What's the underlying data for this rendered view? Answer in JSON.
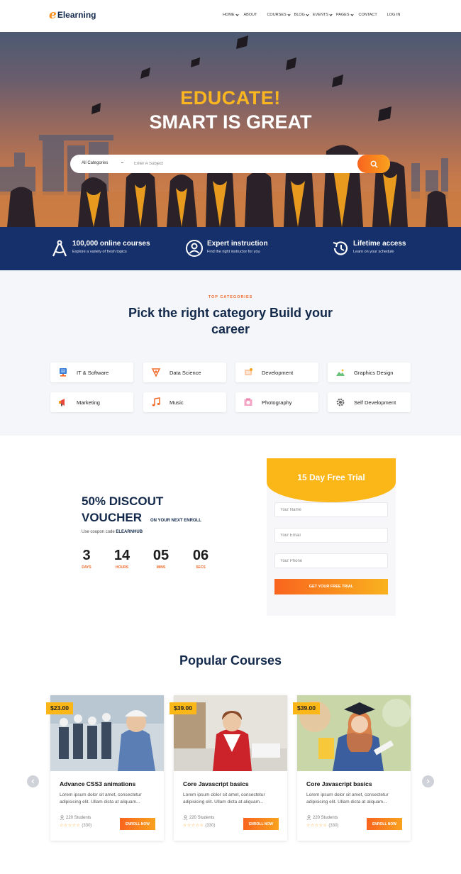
{
  "header": {
    "logo": "Elearning",
    "logo_initial": "e",
    "nav": [
      {
        "label": "HOME",
        "dropdown": true
      },
      {
        "label": "ABOUT",
        "dropdown": false
      },
      {
        "label": "COURSES",
        "dropdown": true
      },
      {
        "label": "BLOG",
        "dropdown": true
      },
      {
        "label": "EVENTS",
        "dropdown": true
      },
      {
        "label": "PAGES",
        "dropdown": true
      },
      {
        "label": "CONTACT",
        "dropdown": false
      },
      {
        "label": "LOG IN",
        "dropdown": false
      }
    ]
  },
  "hero": {
    "title1": "EDUCATE!",
    "title2": "SMART IS GREAT",
    "search": {
      "category": "All Categories",
      "placeholder": "Enter A Subject"
    }
  },
  "features": [
    {
      "title": "100,000 online courses",
      "subtitle": "Explore a variety of fresh topics",
      "icon": "compass-icon"
    },
    {
      "title": "Expert instruction",
      "subtitle": "Find the right instructor for you",
      "icon": "user-circle-icon"
    },
    {
      "title": "Lifetime access",
      "subtitle": "Learn on your schedule",
      "icon": "history-icon"
    }
  ],
  "categories": {
    "eyebrow": "TOP CATEGORIES",
    "title": "Pick the right category Build your career",
    "items": [
      {
        "label": "IT & Software",
        "icon": "server-icon"
      },
      {
        "label": "Data Science",
        "icon": "data-science-icon"
      },
      {
        "label": "Development",
        "icon": "development-icon"
      },
      {
        "label": "Graphics Design",
        "icon": "landscape-icon"
      },
      {
        "label": "Marketing",
        "icon": "megaphone-icon"
      },
      {
        "label": "Music",
        "icon": "music-note-icon"
      },
      {
        "label": "Photography",
        "icon": "photo-icon"
      },
      {
        "label": "Self Development",
        "icon": "gear-icon"
      }
    ]
  },
  "voucher": {
    "title1": "50% DISCOUT",
    "title2": "VOUCHER",
    "title2_sub": "ON YOUR NEXT ENROLL",
    "coupon_prefix": "Use coupon code",
    "coupon_code": "ELEARNHUB",
    "countdown": [
      {
        "value": "3",
        "label": "DAYS"
      },
      {
        "value": "14",
        "label": "HOURS"
      },
      {
        "value": "05",
        "label": "MINS"
      },
      {
        "value": "06",
        "label": "SECS"
      }
    ]
  },
  "trial": {
    "title": "15 Day Free Trial",
    "name_placeholder": "Your Name",
    "email_placeholder": "Your Email",
    "phone_placeholder": "Your Phone",
    "button": "GET YOUR FREE TRIAL"
  },
  "courses": {
    "title": "Popular Courses",
    "items": [
      {
        "price": "$23.00",
        "title": "Advance CSS3 animations",
        "desc": "Lorem ipsum dolor sit amet, consectetur adipisicing elit. Ullam dicta at aliquam...",
        "students": "220 Students",
        "rating": "(330)",
        "enroll": "ENROLL NOW"
      },
      {
        "price": "$39.00",
        "title": "Core Javascript basics",
        "desc": "Lorem ipsum dolor sit amet, consectetur adipisicing elit. Ullam dicta at aliquam...",
        "students": "220 Students",
        "rating": "(330)",
        "enroll": "ENROLL NOW"
      },
      {
        "price": "$39.00",
        "title": "Core Javascript basics",
        "desc": "Lorem ipsum dolor sit amet, consectetur adipisicing elit. Ullam dicta at aliquam...",
        "students": "220 Students",
        "rating": "(330)",
        "enroll": "ENROLL NOW"
      }
    ]
  },
  "colors": {
    "accent": "#f9641e",
    "yellow": "#fbb617",
    "navy": "#15306a",
    "heading": "#13294b"
  }
}
